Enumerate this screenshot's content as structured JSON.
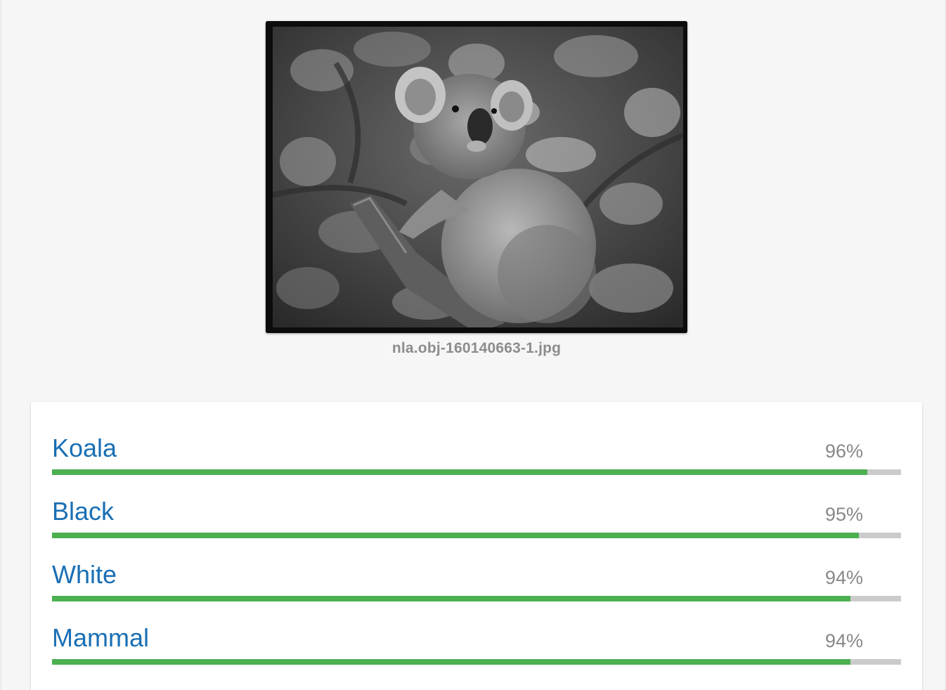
{
  "image": {
    "filename": "nla.obj-160140663-1.jpg",
    "description_icon": "koala-photo"
  },
  "labels": [
    {
      "name": "Koala",
      "score_text": "96%",
      "score": 0.96
    },
    {
      "name": "Black",
      "score_text": "95%",
      "score": 0.95
    },
    {
      "name": "White",
      "score_text": "94%",
      "score": 0.94
    },
    {
      "name": "Mammal",
      "score_text": "94%",
      "score": 0.94
    }
  ],
  "colors": {
    "label_text": "#1a6fb4",
    "bar_fill": "#4caf50",
    "bar_track": "#cbcbcb",
    "score_text": "#888888"
  }
}
